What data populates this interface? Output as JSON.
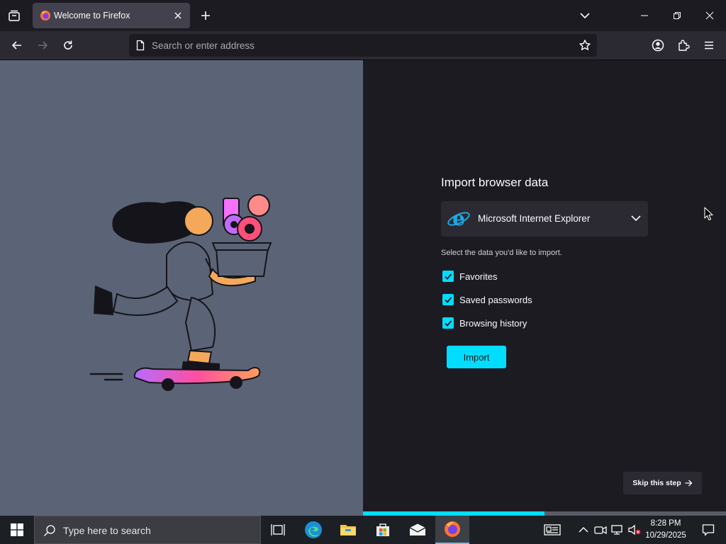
{
  "tab": {
    "title": "Welcome to Firefox"
  },
  "urlbar": {
    "placeholder": "Search or enter address"
  },
  "import": {
    "title": "Import browser data",
    "browser": "Microsoft Internet Explorer",
    "hint": "Select the data you'd like to import.",
    "options": [
      {
        "label": "Favorites",
        "checked": true
      },
      {
        "label": "Saved passwords",
        "checked": true
      },
      {
        "label": "Browsing history",
        "checked": true
      }
    ],
    "button": "Import"
  },
  "skip": {
    "label": "Skip this step"
  },
  "progress": {
    "fraction": 0.5
  },
  "colors": {
    "accent": "#00ddff",
    "panel": "#5b6476",
    "bg": "#1c1b22"
  },
  "taskbar": {
    "search_placeholder": "Type here to search",
    "time": "8:28 PM",
    "date": "10/29/2025"
  },
  "icons": [
    "tab-list-icon",
    "firefox-icon",
    "close-icon",
    "plus-icon",
    "chevron-down-icon",
    "minimize-icon",
    "restore-icon",
    "back-icon",
    "forward-icon",
    "reload-icon",
    "page-icon",
    "star-icon",
    "account-icon",
    "extensions-icon",
    "menu-icon",
    "ie-icon",
    "check-icon",
    "arrow-right-icon",
    "windows-icon",
    "search-icon",
    "task-view-icon",
    "edge-icon",
    "folder-icon",
    "store-icon",
    "mail-icon",
    "news-icon",
    "chevron-up-icon",
    "meet-icon",
    "network-icon",
    "volume-icon",
    "notification-icon"
  ]
}
